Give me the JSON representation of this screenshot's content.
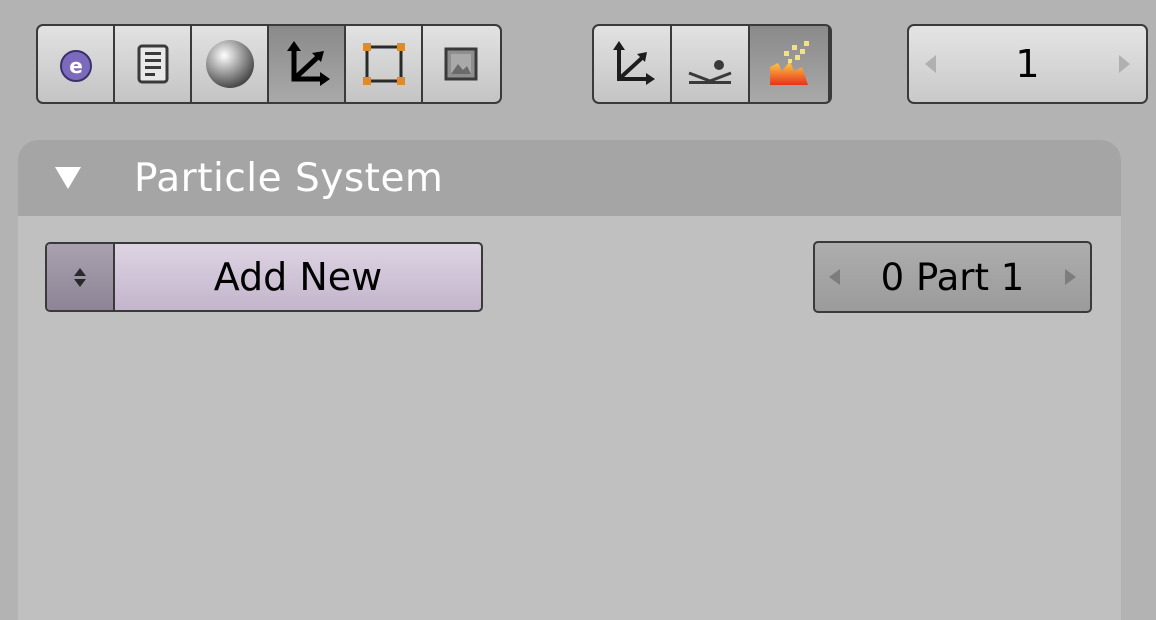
{
  "header": {
    "context_buttons": [
      {
        "icon": "logic-icon",
        "active": false
      },
      {
        "icon": "script-icon",
        "active": false
      },
      {
        "icon": "material-sphere-icon",
        "active": false
      },
      {
        "icon": "object-axes-icon",
        "active": true
      },
      {
        "icon": "editing-square-icon",
        "active": false
      },
      {
        "icon": "scene-image-icon",
        "active": false
      }
    ],
    "object_sub_buttons": [
      {
        "icon": "object-axes-icon",
        "active": false
      },
      {
        "icon": "physics-icon",
        "active": false
      },
      {
        "icon": "particles-icon",
        "active": true
      }
    ],
    "frame_counter": {
      "value": "1"
    }
  },
  "panel": {
    "title": "Particle System",
    "add_new_label": "Add New",
    "part_selector": {
      "value": "0 Part 1"
    }
  },
  "colors": {
    "background": "#b3b3b3",
    "panel_body": "#c0c0c0",
    "panel_header": "#a5a5a5",
    "add_new_button": "#cfc4d8"
  }
}
